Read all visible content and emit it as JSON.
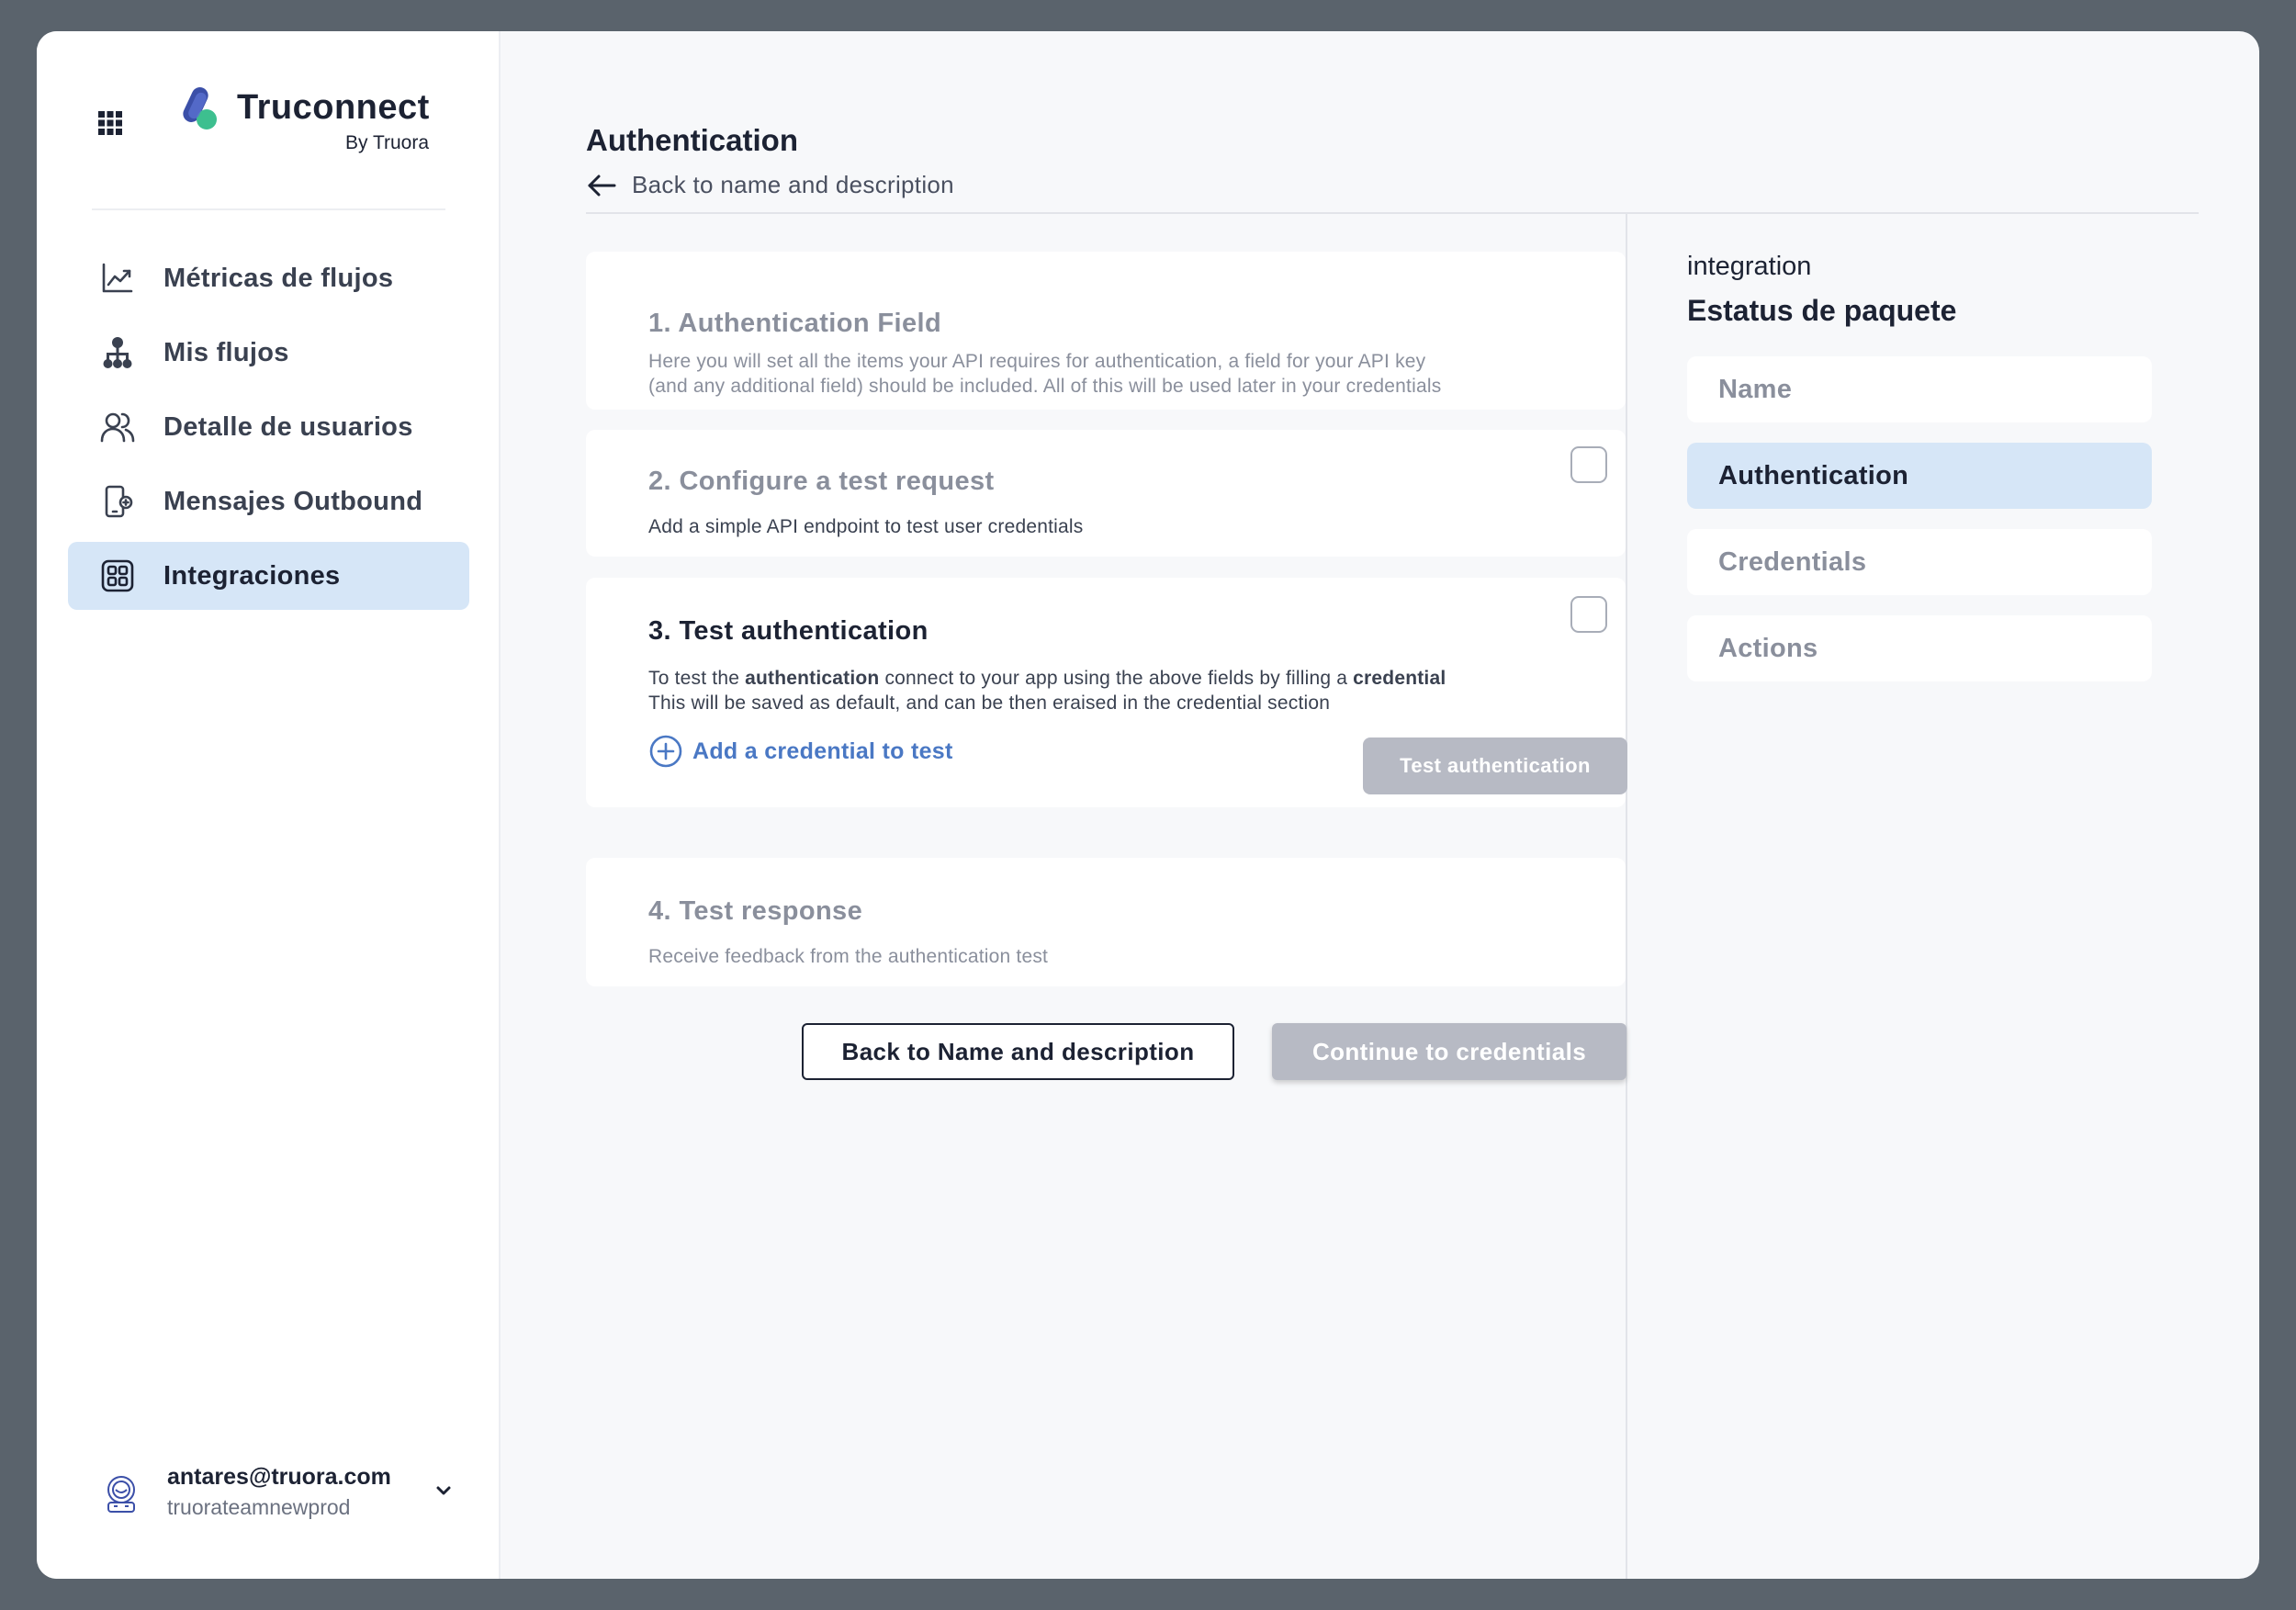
{
  "brand": {
    "name": "Truconnect",
    "sub": "By Truora",
    "colors": {
      "primary": "#3b4fa8",
      "accent": "#3dbf8f"
    }
  },
  "sidebar": {
    "menu_icon": "grid-icon",
    "items": [
      {
        "label": "Métricas de flujos",
        "icon": "line-chart-icon",
        "active": false
      },
      {
        "label": "Mis flujos",
        "icon": "flow-tree-icon",
        "active": false
      },
      {
        "label": "Detalle de usuarios",
        "icon": "users-icon",
        "active": false
      },
      {
        "label": "Mensajes Outbound",
        "icon": "phone-message-icon",
        "active": false
      },
      {
        "label": "Integraciones",
        "icon": "integrations-icon",
        "active": true
      }
    ],
    "user": {
      "email": "antares@truora.com",
      "team": "truorateamnewprod",
      "icon": "astronaut-avatar-icon"
    }
  },
  "main": {
    "title": "Authentication",
    "back_link": "Back to name and description",
    "cards": [
      {
        "title": "1. Authentication Field",
        "desc_1": "Here you will set all the items your API requires for authentication, a field for your API key",
        "desc_2": "(and any additional field) should be included. All of this will be used later in your credentials"
      },
      {
        "title": "2. Configure a test request",
        "desc_1": "Add a simple API endpoint to test user credentials",
        "checked": false
      },
      {
        "title": "3. Test authentication",
        "desc_1_a": "To test the ",
        "desc_1_b": "authentication",
        "desc_1_c": " connect to your app using the above fields by filling a ",
        "desc_1_d": "credential",
        "desc_2": "This will be saved as default, and can be then eraised in the credential section",
        "add_link": "Add a credential to test",
        "test_button": "Test authentication",
        "checked": false
      },
      {
        "title": "4. Test response",
        "desc_1": "Receive feedback from the authentication test"
      }
    ],
    "back_button": "Back to Name and description",
    "continue_button": "Continue to credentials"
  },
  "right_panel": {
    "small_label": "integration",
    "title": "Estatus de paquete",
    "steps": [
      {
        "label": "Name",
        "active": false
      },
      {
        "label": "Authentication",
        "active": true
      },
      {
        "label": "Credentials",
        "active": false
      },
      {
        "label": "Actions",
        "active": false
      }
    ]
  }
}
